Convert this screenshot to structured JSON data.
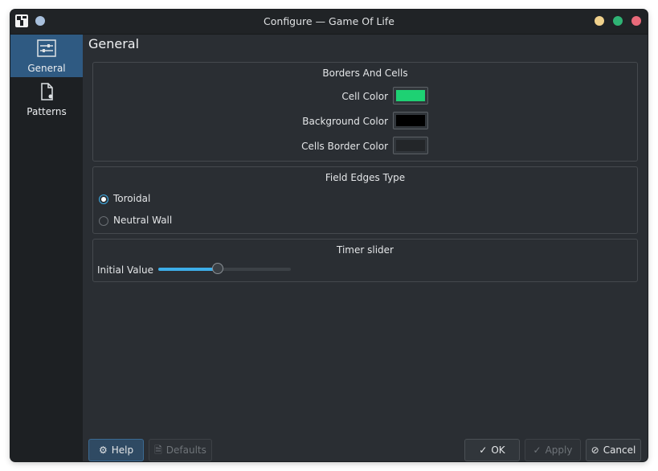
{
  "window": {
    "title": "Configure — Game Of Life"
  },
  "sidebar": {
    "items": [
      {
        "label": "General",
        "icon": "sliders-icon",
        "active": true
      },
      {
        "label": "Patterns",
        "icon": "document-icon",
        "active": false
      }
    ]
  },
  "page": {
    "title": "General"
  },
  "borders_and_cells": {
    "title": "Borders And Cells",
    "rows": [
      {
        "label": "Cell Color",
        "color": "#1ed173"
      },
      {
        "label": "Background Color",
        "color": "#000000"
      },
      {
        "label": "Cells Border Color",
        "color": "#232629"
      }
    ]
  },
  "field_edges": {
    "title": "Field Edges Type",
    "options": [
      {
        "label": "Toroidal",
        "selected": true
      },
      {
        "label": "Neutral Wall",
        "selected": false
      }
    ]
  },
  "timer_slider": {
    "title": "Timer slider",
    "label": "Initial Value",
    "value_fraction": 0.45
  },
  "buttons": {
    "help": "Help",
    "defaults": "Defaults",
    "ok": "OK",
    "apply": "Apply",
    "cancel": "Cancel"
  },
  "colors": {
    "accent": "#3daee9",
    "selection": "#2f5a82"
  }
}
